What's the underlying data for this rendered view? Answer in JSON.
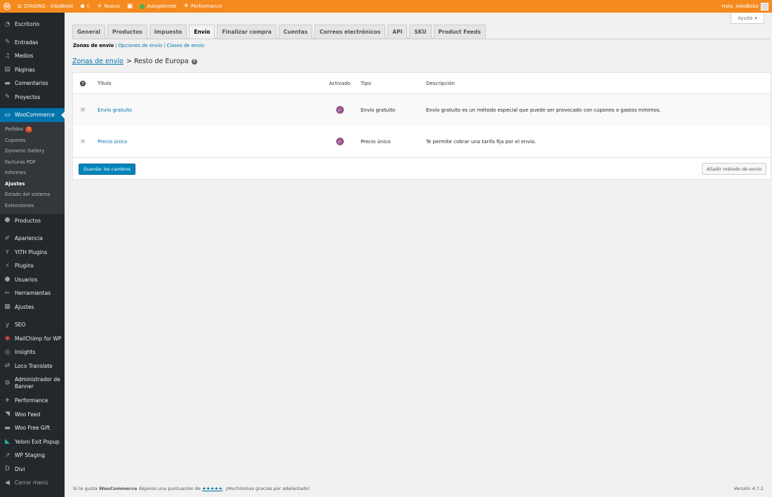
{
  "adminbar": {
    "site": "STAGING - AikoBebé",
    "comments_count": "0",
    "new_label": "Nuevo",
    "autoptimize": "Autoptimize",
    "performance": "Performance",
    "greeting": "Hola, AikoBebé"
  },
  "sidebar": {
    "dashboard": "Escritorio",
    "posts": "Entradas",
    "media": "Medios",
    "pages": "Páginas",
    "comments": "Comentarios",
    "projects": "Proyectos",
    "woocommerce": "WooCommerce",
    "sub": {
      "orders": "Pedidos",
      "orders_badge": "1",
      "coupons": "Cupones",
      "gallery": "Dynamic Gallery",
      "invoices": "Facturas PDF",
      "reports": "Informes",
      "settings": "Ajustes",
      "status": "Estado del sistema",
      "extensions": "Extensiones"
    },
    "products": "Productos",
    "appearance": "Apariencia",
    "yith": "YITH Plugins",
    "plugins": "Plugins",
    "users": "Usuarios",
    "tools": "Herramientas",
    "settings": "Ajustes",
    "seo": "SEO",
    "mailchimp": "MailChimp for WP",
    "insights": "Insights",
    "loco": "Loco Translate",
    "banner_admin": "Administrador de Banner",
    "performance": "Performance",
    "woo_feed": "Woo Feed",
    "woo_gift": "Woo Free Gift",
    "yeloni": "Yeloni Exit Popup",
    "wp_staging": "WP Staging",
    "divi": "Divi",
    "collapse": "Cerrar menú"
  },
  "help_label": "Ayuda",
  "tabs": {
    "general": "General",
    "products": "Productos",
    "tax": "Impuesto",
    "shipping": "Envío",
    "checkout": "Finalizar compra",
    "accounts": "Cuentas",
    "emails": "Correos electrónicos",
    "api": "API",
    "sku": "SKU",
    "feeds": "Product Feeds"
  },
  "subnav": {
    "zones": "Zonas de envío",
    "options": "Opciones de envío",
    "classes": "Clases de envío",
    "sep": "|"
  },
  "heading": {
    "link": "Zonas de envío",
    "rest": "> Resto de Europa",
    "help_glyph": "?"
  },
  "table": {
    "help_glyph": "?",
    "columns": {
      "title": "Título",
      "enabled": "Activado",
      "type": "Tipo",
      "description": "Descripción"
    },
    "rows": [
      {
        "title": "Envío gratuito",
        "type": "Envío gratuito",
        "description": "Envío gratuito es un método especial que puede ser provocado con cupones o gastos mínimos."
      },
      {
        "title": "Precio único",
        "type": "Precio único",
        "description": "Te permite cobrar una tarifa fija por el envío."
      }
    ],
    "save_button": "Guardar los cambios",
    "add_button": "Añadir método de envío"
  },
  "footer": {
    "prefix": "Si te gusta",
    "brand": "WooCommerce",
    "middle": "déjanos una puntuación de",
    "stars": "★★★★★",
    "suffix": ". ¡Muchísimas gracias por adelantado!",
    "version": "Versión 4.7.2"
  },
  "colors": {
    "adminbar": "#f58a1f",
    "sidebar": "#23282d",
    "accent": "#0073aa",
    "check": "#96588a"
  }
}
